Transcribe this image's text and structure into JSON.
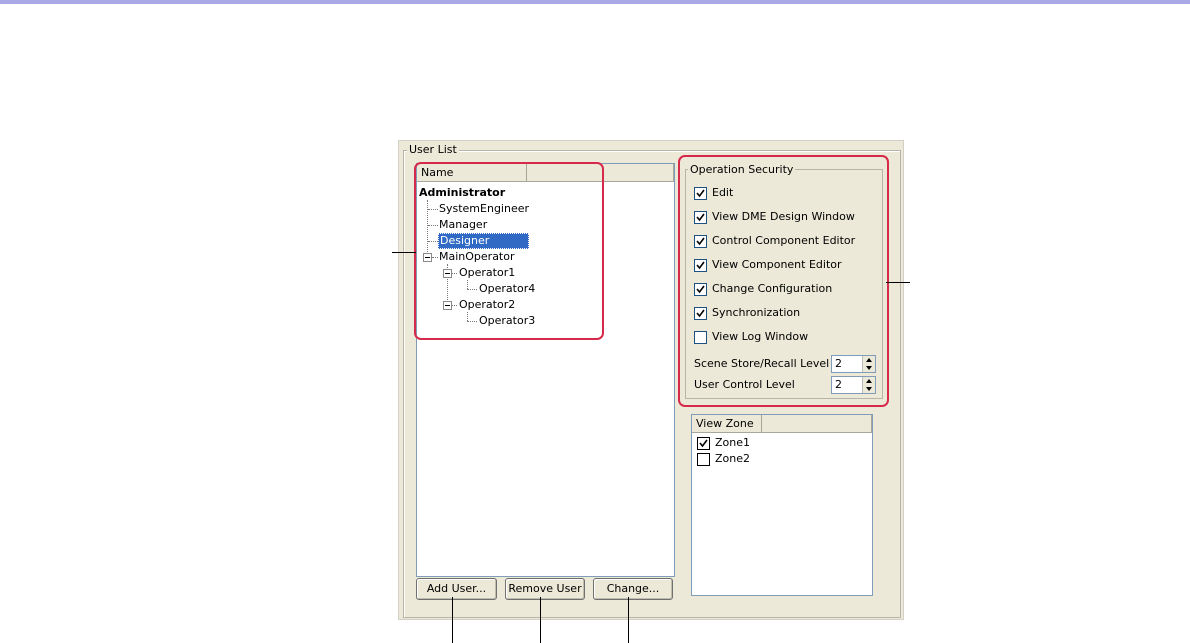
{
  "user_list": {
    "legend": "User List",
    "column_header": "Name",
    "tree": [
      {
        "label": "Administrator"
      },
      {
        "label": "SystemEngineer"
      },
      {
        "label": "Manager"
      },
      {
        "label": "Designer",
        "selected": true
      },
      {
        "label": "MainOperator"
      },
      {
        "label": "Operator1"
      },
      {
        "label": "Operator4"
      },
      {
        "label": "Operator2"
      },
      {
        "label": "Operator3"
      }
    ]
  },
  "buttons": {
    "add_user": "Add User...",
    "remove_user": "Remove User",
    "change": "Change..."
  },
  "operation_security": {
    "legend": "Operation Security",
    "items": [
      {
        "label": "Edit",
        "checked": true
      },
      {
        "label": "View DME Design Window",
        "checked": true
      },
      {
        "label": "Control Component Editor",
        "checked": true
      },
      {
        "label": "View Component Editor",
        "checked": true
      },
      {
        "label": "Change Configuration",
        "checked": true
      },
      {
        "label": "Synchronization",
        "checked": true
      },
      {
        "label": "View Log Window",
        "checked": false
      }
    ],
    "scene_store_label": "Scene Store/Recall Level",
    "scene_store_value": "2",
    "user_control_label": "User Control Level",
    "user_control_value": "2"
  },
  "view_zone": {
    "column_header": "View Zone",
    "zones": [
      {
        "label": "Zone1",
        "checked": true
      },
      {
        "label": "Zone2",
        "checked": false
      }
    ]
  },
  "colors": {
    "highlight": "#d62a4a",
    "selection": "#316ac5",
    "dialog_bg": "#ece9d8"
  }
}
